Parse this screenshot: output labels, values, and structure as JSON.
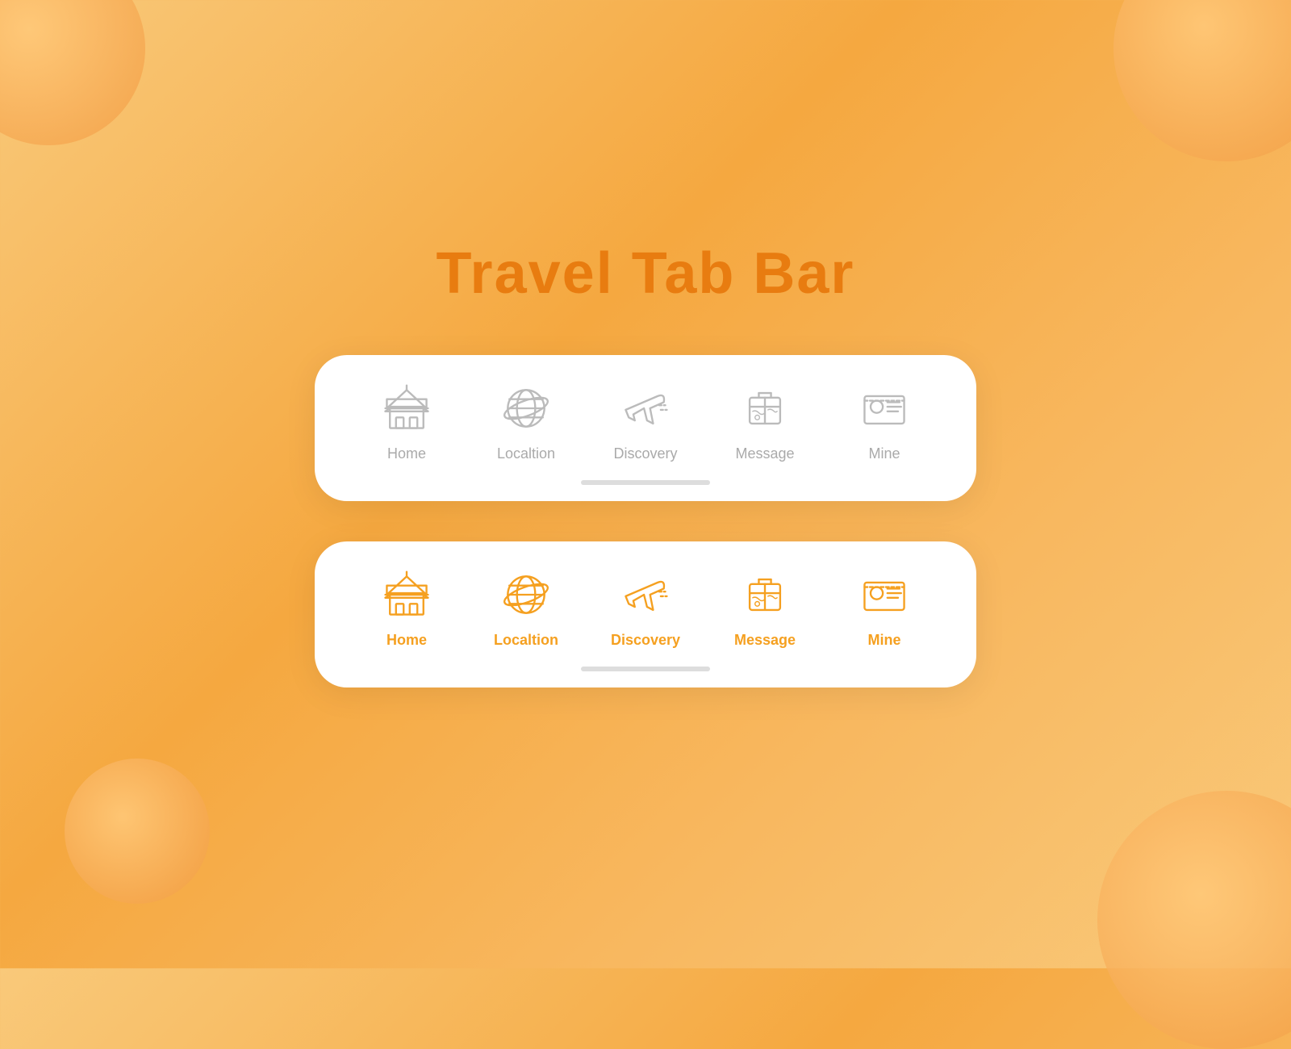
{
  "page": {
    "title": "Travel Tab Bar",
    "bg_color": "#f5a840",
    "accent_color": "#f5a020",
    "title_color": "#e87c10"
  },
  "tab_bars": [
    {
      "id": "inactive",
      "style": "gray",
      "items": [
        {
          "id": "home",
          "label": "Home",
          "icon": "home-icon"
        },
        {
          "id": "location",
          "label": "Localtion",
          "icon": "location-icon"
        },
        {
          "id": "discovery",
          "label": "Discovery",
          "icon": "discovery-icon",
          "active": false
        },
        {
          "id": "message",
          "label": "Message",
          "icon": "message-icon"
        },
        {
          "id": "mine",
          "label": "Mine",
          "icon": "mine-icon"
        }
      ]
    },
    {
      "id": "active",
      "style": "orange",
      "items": [
        {
          "id": "home",
          "label": "Home",
          "icon": "home-icon"
        },
        {
          "id": "location",
          "label": "Localtion",
          "icon": "location-icon"
        },
        {
          "id": "discovery",
          "label": "Discovery",
          "icon": "discovery-icon",
          "active": true
        },
        {
          "id": "message",
          "label": "Message",
          "icon": "message-icon"
        },
        {
          "id": "mine",
          "label": "Mine",
          "icon": "mine-icon"
        }
      ]
    }
  ],
  "scroll_indicator": {
    "label": "scroll-bar"
  }
}
